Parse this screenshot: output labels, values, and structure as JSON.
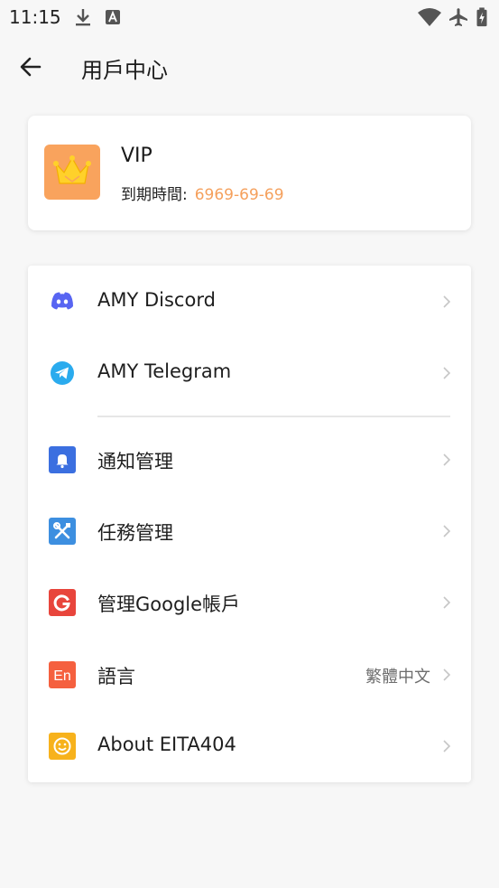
{
  "status": {
    "time": "11:15"
  },
  "header": {
    "title": "用戶中心"
  },
  "vip": {
    "label": "VIP",
    "expiry_label": "到期時間:",
    "expiry_date": "6969-69-69"
  },
  "menu": [
    {
      "label": "AMY Discord",
      "icon": "discord-icon",
      "color": "#5865f2"
    },
    {
      "label": "AMY Telegram",
      "icon": "telegram-icon",
      "color": "#2aabee"
    },
    {
      "label": "通知管理",
      "icon": "bell-icon",
      "color": "#3b6fe0"
    },
    {
      "label": "任務管理",
      "icon": "tools-icon",
      "color": "#3d8fe0"
    },
    {
      "label": "管理Google帳戶",
      "icon": "google-icon",
      "color": "#e8453c"
    },
    {
      "label": "語言",
      "icon": "language-icon",
      "color": "#f5603f",
      "value": "繁體中文",
      "icon_text": "En"
    },
    {
      "label": "About EITA404",
      "icon": "smiley-icon",
      "color": "#f7b21c"
    }
  ]
}
